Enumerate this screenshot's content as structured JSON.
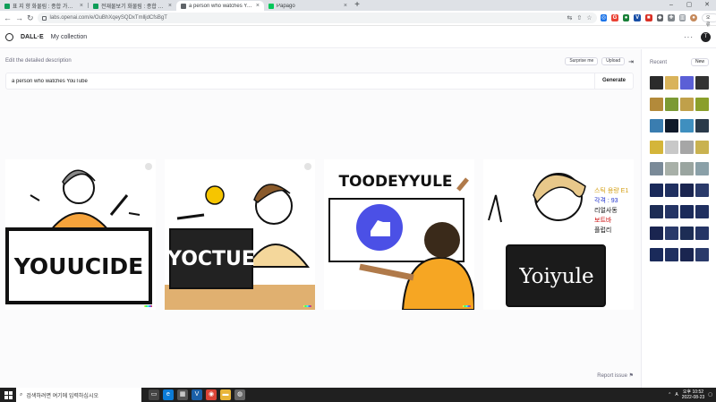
{
  "browser": {
    "tabs": [
      {
        "title": "표 지 향 화물림 : 종합 가시기",
        "color": "#0f9d58",
        "active": false
      },
      {
        "title": "전재물보기 화물림 : 종합 가시",
        "color": "#0f9d58",
        "active": false
      },
      {
        "title": "a person who watches YouTube",
        "color": "#5f6368",
        "active": true
      },
      {
        "title": "Papago",
        "color": "#03c75a",
        "active": false
      }
    ],
    "new_tab": "+",
    "url": "labs.openai.com/e/OuBhXqeySQDxTmlljdCfsBgT",
    "profile_label": "오류"
  },
  "app": {
    "brand": "DALL·E",
    "nav_collection": "My collection",
    "avatar_initial": "T",
    "more": "···"
  },
  "editor": {
    "label": "Edit the detailed description",
    "surprise_label": "Surprise me",
    "upload_label": "Upload",
    "prompt_value": "a person who watches YouTube",
    "generate_label": "Generate"
  },
  "gallery": {
    "images": [
      {
        "text": "YOUUCIDE",
        "bg": "#ffffff",
        "accent": "#f6a33b"
      },
      {
        "text": "YOCTUE",
        "bg": "#ffffff",
        "accent": "#f4d79b"
      },
      {
        "text": "TOODEYYULE",
        "bg": "#ffffff",
        "accent": "#f6a623"
      },
      {
        "text": "Yoiyule",
        "bg": "#ffffff",
        "accent": "#7a8fa6"
      }
    ],
    "report_label": "Report issue"
  },
  "recent": {
    "title": "Recent",
    "new_label": "New",
    "thumb_colors": [
      "#2b2b2b",
      "#d9b35a",
      "#5b5fd6",
      "#333333",
      "#b38a3a",
      "#7b9a34",
      "#c0a04a",
      "#8a9f2a",
      "#3a7db0",
      "#101a2a",
      "#3f8fbf",
      "#2a3a4a",
      "#d4b53a",
      "#c8c8c8",
      "#a6a6a6",
      "#c9b250",
      "#7a8a98",
      "#a8b0a8",
      "#9aa5a0",
      "#8aa0a8",
      "#1a2a5a",
      "#203060",
      "#1a2550",
      "#2a3a6a",
      "#1d2d55",
      "#253565",
      "#1a2a5a",
      "#203060",
      "#1a2550",
      "#2a3a6a",
      "#1d2d55",
      "#253565",
      "#1a2a5a",
      "#203060",
      "#1a2550",
      "#2a3a6a"
    ],
    "overlay_lines": [
      {
        "text": "스틱 용량 E1",
        "color": "#d4a017"
      },
      {
        "text": "각격 : 93",
        "color": "#2233cc"
      },
      {
        "text": "리얼사동",
        "color": "#111111"
      },
      {
        "text": "보트바",
        "color": "#cc1111"
      },
      {
        "text": "플럽리",
        "color": "#111111"
      }
    ]
  },
  "taskbar": {
    "search_placeholder": "검색하려면 여기에 입력하십시오",
    "time": "오후 10:52",
    "date": "2022-08-23",
    "ime": "A"
  }
}
